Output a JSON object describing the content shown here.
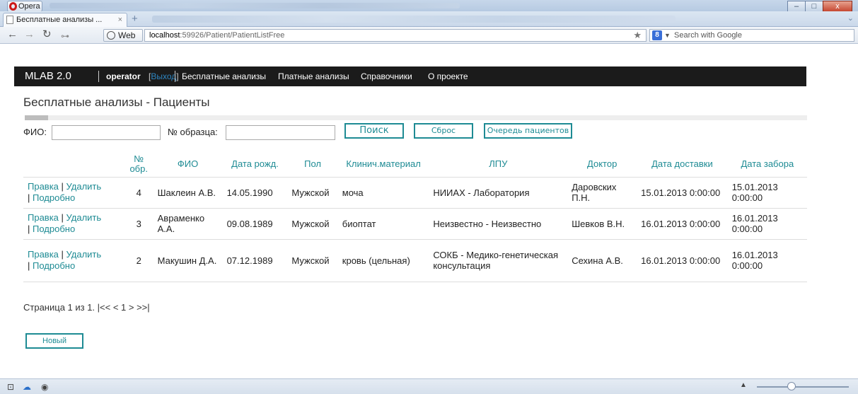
{
  "browser": {
    "app_button": "Opera",
    "tab_title": "Бесплатные анализы ...",
    "tab_close": "×",
    "new_tab": "+",
    "web_chip": "Web",
    "url_host": "localhost",
    "url_path": ":59926/Patient/PatientListFree",
    "search_engine_icon": "8",
    "search_placeholder": "Search with Google",
    "minimize": "–",
    "maximize": "□",
    "close": "x"
  },
  "nav": {
    "brand": "MLAB 2.0",
    "user": "operator",
    "logout_open": "[",
    "logout": "Выход",
    "logout_close": "]",
    "items": [
      "Бесплатные анализы",
      "Платные анализы",
      "Справочники",
      "О проекте"
    ]
  },
  "page": {
    "title": "Бесплатные анализы - Пациенты",
    "loading_progress": 0.003
  },
  "filter": {
    "fio_label": "ФИО:",
    "fio_value": "",
    "sample_label": "№ образца:",
    "sample_value": "",
    "search_button": "Поиск",
    "reset_button": "Сброс",
    "queue_button": "Очередь пациентов"
  },
  "table": {
    "headers": {
      "actions": "",
      "num_line1": "№",
      "num_line2": "обр.",
      "fio": "ФИО",
      "dob": "Дата рожд.",
      "sex": "Пол",
      "material": "Клинич.материал",
      "lpu": "ЛПУ",
      "doctor": "Доктор",
      "delivery": "Дата доставки",
      "collection": "Дата забора"
    },
    "link_edit": "Правка",
    "link_delete": "Удалить",
    "link_details": "Подробно",
    "rows": [
      {
        "num": "4",
        "fio": "Шаклеин А.В.",
        "dob": "14.05.1990",
        "sex": "Мужской",
        "material": "моча",
        "lpu": "НИИАХ - Лаборатория",
        "doctor": "Даровских П.Н.",
        "delivery": "15.01.2013 0:00:00",
        "collection": "15.01.2013 0:00:00"
      },
      {
        "num": "3",
        "fio": "Авраменко А.А.",
        "dob": "09.08.1989",
        "sex": "Мужской",
        "material": "биоптат",
        "lpu": "Неизвестно - Неизвестно",
        "doctor": "Шевков В.Н.",
        "delivery": "16.01.2013 0:00:00",
        "collection": "16.01.2013 0:00:00"
      },
      {
        "num": "2",
        "fio": "Макушин Д.А.",
        "dob": "07.12.1989",
        "sex": "Мужской",
        "material": "кровь (цельная)",
        "lpu": "СОКБ - Медико-генетическая консультация",
        "doctor": "Сехина А.В.",
        "delivery": "16.01.2013 0:00:00",
        "collection": "16.01.2013 0:00:00"
      }
    ]
  },
  "pager": {
    "text": "Страница 1 из 1. |<< < 1 > >>|"
  },
  "new_button": "Новый",
  "colors": {
    "accent": "#1e8b94",
    "nav_bg": "#1b1b1b"
  }
}
